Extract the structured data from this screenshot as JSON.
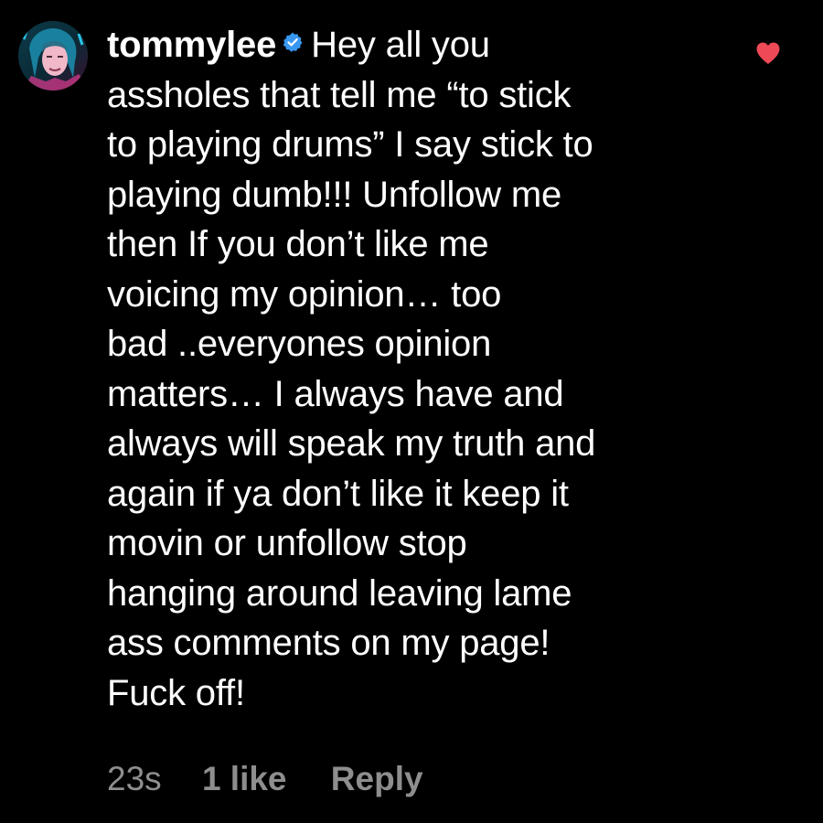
{
  "comment": {
    "username": "tommylee",
    "verified": true,
    "text_lines": [
      "Hey all you",
      "assholes that tell me “to stick",
      "to playing drums” I say stick to",
      "playing dumb!!! Unfollow me",
      "then If you don’t like me",
      "voicing my opinion… too",
      "bad ..everyones opinion",
      "matters… I always have and",
      "always will speak my truth and",
      "again if ya don’t like it keep it",
      "movin or unfollow stop",
      "hanging around leaving lame",
      "ass comments on my page!",
      "Fuck off!"
    ],
    "liked": true,
    "icons": {
      "avatar": "profile-avatar",
      "verified": "verified-badge-icon",
      "like": "heart-icon"
    }
  },
  "meta": {
    "timestamp": "23s",
    "likes": "1 like",
    "reply_label": "Reply"
  },
  "colors": {
    "background": "#000000",
    "text": "#ffffff",
    "meta_text": "#8e8e8e",
    "verified_badge": "#3897f0",
    "heart": "#ed4956"
  }
}
